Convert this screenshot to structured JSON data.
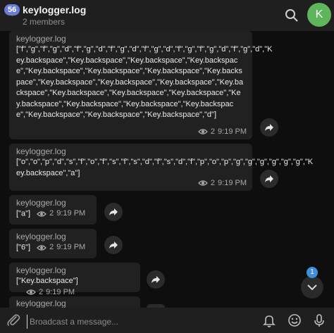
{
  "header": {
    "back_badge": "56",
    "title": "keylogger.log",
    "subtitle": "2 members",
    "avatar_letter": "K"
  },
  "messages": [
    {
      "author": "keylogger.log",
      "text": "[\"f\",\"g\",\"f\",\"g\",\"d\",\"f\",\"g\",\"d\",\"f\",\"g\",\"d\",\"f\",\"g\",\"d\",\"f\",\"g\",\"f\",\"g\",\"d\",\"f\",\"g\",\"d\",\"Key.backspace\",\"Key.backspace\",\"Key.backspace\",\"Key.backspace\",\"Key.backspace\",\"Key.backspace\",\"Key.backspace\",\"Key.backspace\",\"Key.backspace\",\"Key.backspace\",\"Key.backspace\",\"Key.backspace\",\"Key.backspace\",\"Key.backspace\",\"Key.backspace\",\"Key.backspace\",\"Key.backspace\",\"Key.backspace\",\"Key.backspace\",\"Key.backspace\",\"Key.backspace\",\"Key.backspace\",\"d\"]",
      "views": "2",
      "time": "9:19 PM"
    },
    {
      "author": "keylogger.log",
      "text": "[\"o\",\"o\",\"p\",\"d\",\"s\",\"f\",\"o\",\"f\",\"s\",\"f\",\"s\",\"d\",\"f\",\"s\",\"d\",\"f\",\"p\",\"o\",\"p\",\"g\",\"g\",\"g\",\"g\",\"g\",\"g\",\"Key.backspace\",\"a\"]",
      "views": "2",
      "time": "9:19 PM"
    },
    {
      "author": "keylogger.log",
      "text": "[\"a\"]",
      "views": "2",
      "time": "9:19 PM"
    },
    {
      "author": "keylogger.log",
      "text": "[\"6\"]",
      "views": "2",
      "time": "9:19 PM"
    },
    {
      "author": "keylogger.log",
      "text": "[\"Key.backspace\"]",
      "views": "2",
      "time": "9:19 PM"
    },
    {
      "author": "keylogger.log"
    }
  ],
  "scroll": {
    "unread": "1"
  },
  "composer": {
    "placeholder": "Broadcast a message..."
  }
}
